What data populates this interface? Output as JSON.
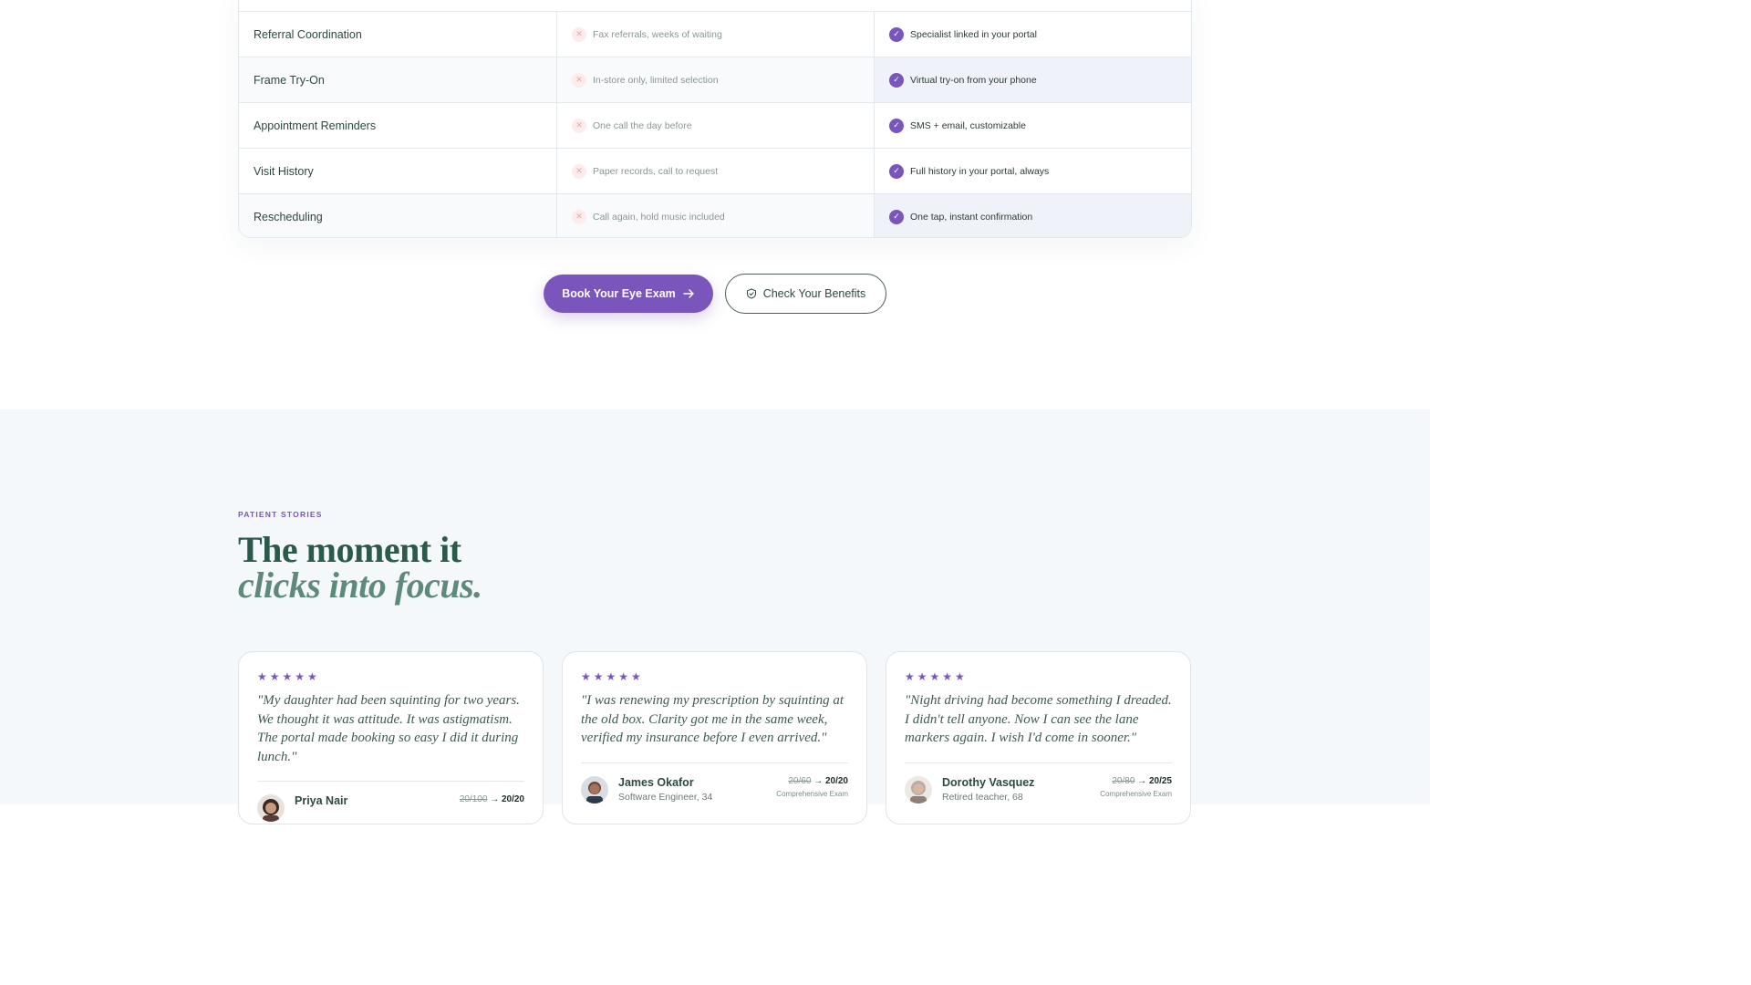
{
  "comparison": {
    "rows": [
      {
        "feature": "Referral Coordination",
        "old": "Fax referrals, weeks of waiting",
        "new": "Specialist linked in your portal"
      },
      {
        "feature": "Frame Try-On",
        "old": "In-store only, limited selection",
        "new": "Virtual try-on from your phone"
      },
      {
        "feature": "Appointment Reminders",
        "old": "One call the day before",
        "new": "SMS + email, customizable"
      },
      {
        "feature": "Visit History",
        "old": "Paper records, call to request",
        "new": "Full history in your portal, always"
      },
      {
        "feature": "Rescheduling",
        "old": "Call again, hold music included",
        "new": "One tap, instant confirmation"
      }
    ]
  },
  "cta": {
    "primary_label": "Book Your Eye Exam",
    "secondary_label": "Check Your Benefits"
  },
  "stories": {
    "eyebrow": "PATIENT STORIES",
    "headline_line1": "The moment it",
    "headline_line2": "clicks into focus.",
    "cards": [
      {
        "stars": "★★★★★",
        "quote": "\"My daughter had been squinting for two years. We thought it was attitude. It was astigmatism. The portal made booking so easy I did it during lunch.\"",
        "name": "Priya Nair",
        "role": "",
        "vision_before": "20/100",
        "vision_after": "20/20",
        "exam": ""
      },
      {
        "stars": "★★★★★",
        "quote": "\"I was renewing my prescription by squinting at the old box. Clarity got me in the same week, verified my insurance before I even arrived.\"",
        "name": "James Okafor",
        "role": "Software Engineer, 34",
        "vision_before": "20/60",
        "vision_after": "20/20",
        "exam": "Comprehensive Exam"
      },
      {
        "stars": "★★★★★",
        "quote": "\"Night driving had become something I dreaded. I didn't tell anyone. Now I can see the lane markers again. I wish I'd come in sooner.\"",
        "name": "Dorothy Vasquez",
        "role": "Retired teacher, 68",
        "vision_before": "20/80",
        "vision_after": "20/25",
        "exam": "Comprehensive Exam"
      }
    ]
  },
  "colors": {
    "accent": "#7a55bb",
    "heading": "#2c5a4a",
    "section_bg": "#f5f8fb"
  },
  "icons": {
    "x": "x-icon",
    "check": "check-icon",
    "arrow": "arrow-right-icon",
    "shield": "shield-icon",
    "star": "star-icon"
  }
}
